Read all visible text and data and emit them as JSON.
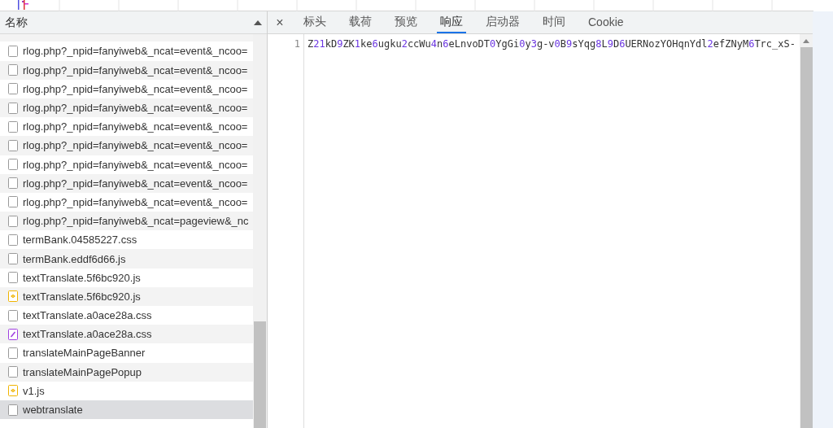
{
  "requests": {
    "header": "名称",
    "rows": [
      {
        "name": "rlog.php?_npid=fanyiweb&_ncat=event&_ncoo=",
        "kind": "document",
        "selected": false
      },
      {
        "name": "rlog.php?_npid=fanyiweb&_ncat=event&_ncoo=",
        "kind": "document",
        "selected": false
      },
      {
        "name": "rlog.php?_npid=fanyiweb&_ncat=event&_ncoo=",
        "kind": "document",
        "selected": false
      },
      {
        "name": "rlog.php?_npid=fanyiweb&_ncat=event&_ncoo=",
        "kind": "document",
        "selected": false
      },
      {
        "name": "rlog.php?_npid=fanyiweb&_ncat=event&_ncoo=",
        "kind": "document",
        "selected": false
      },
      {
        "name": "rlog.php?_npid=fanyiweb&_ncat=event&_ncoo=",
        "kind": "document",
        "selected": false
      },
      {
        "name": "rlog.php?_npid=fanyiweb&_ncat=event&_ncoo=",
        "kind": "document",
        "selected": false
      },
      {
        "name": "rlog.php?_npid=fanyiweb&_ncat=event&_ncoo=",
        "kind": "document",
        "selected": false
      },
      {
        "name": "rlog.php?_npid=fanyiweb&_ncat=event&_ncoo=",
        "kind": "document",
        "selected": false
      },
      {
        "name": "rlog.php?_npid=fanyiweb&_ncat=pageview&_nc",
        "kind": "document",
        "selected": false
      },
      {
        "name": "termBank.04585227.css",
        "kind": "document",
        "selected": false
      },
      {
        "name": "termBank.eddf6d66.js",
        "kind": "document",
        "selected": false
      },
      {
        "name": "textTranslate.5f6bc920.js",
        "kind": "document",
        "selected": false
      },
      {
        "name": "textTranslate.5f6bc920.js",
        "kind": "script",
        "selected": false
      },
      {
        "name": "textTranslate.a0ace28a.css",
        "kind": "document",
        "selected": false
      },
      {
        "name": "textTranslate.a0ace28a.css",
        "kind": "stylesheet",
        "selected": false
      },
      {
        "name": "translateMainPageBanner",
        "kind": "document",
        "selected": false
      },
      {
        "name": "translateMainPagePopup",
        "kind": "document",
        "selected": false
      },
      {
        "name": "v1.js",
        "kind": "script",
        "selected": false
      },
      {
        "name": "webtranslate",
        "kind": "document",
        "selected": true
      }
    ]
  },
  "detail": {
    "close": "×",
    "tabs": [
      {
        "label": "标头",
        "selected": false
      },
      {
        "label": "载荷",
        "selected": false
      },
      {
        "label": "预览",
        "selected": false
      },
      {
        "label": "响应",
        "selected": true
      },
      {
        "label": "启动器",
        "selected": false
      },
      {
        "label": "时间",
        "selected": false
      },
      {
        "label": "Cookie",
        "selected": false
      }
    ],
    "response": {
      "lines": [
        {
          "number": "1",
          "text": "Z21kD9ZK1ke6ugku2ccWu4n6eLnvoDT0YgGi0y3g-v0B9sYqg8L9D6UERNozYOHqnYdl2efZNyM6Trc_xS-"
        }
      ]
    }
  }
}
